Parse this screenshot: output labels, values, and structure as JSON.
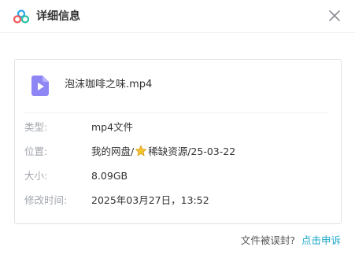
{
  "dialog": {
    "title": "详细信息",
    "logo_icon": "cloud-logo-icon",
    "close_icon": "close-icon"
  },
  "file": {
    "icon": "video-file-icon",
    "name": "泡沫咖啡之味.mp4"
  },
  "details": {
    "type_label": "类型:",
    "type_value": "mp4文件",
    "location_label": "位置:",
    "location_prefix": "我的网盘/",
    "location_star_icon": "star-icon",
    "location_suffix": "稀缺资源/25-03-22",
    "size_label": "大小:",
    "size_value": "8.09GB",
    "modified_label": "修改时间:",
    "modified_value": "2025年03月27日，13:52"
  },
  "footer": {
    "question": "文件被误封?",
    "appeal_link": "点击申诉"
  },
  "colors": {
    "accent_link": "#1aa7c8",
    "label_gray": "#a3a7ad",
    "file_icon_purple": "#8f86f6",
    "star_yellow": "#f5c431"
  }
}
